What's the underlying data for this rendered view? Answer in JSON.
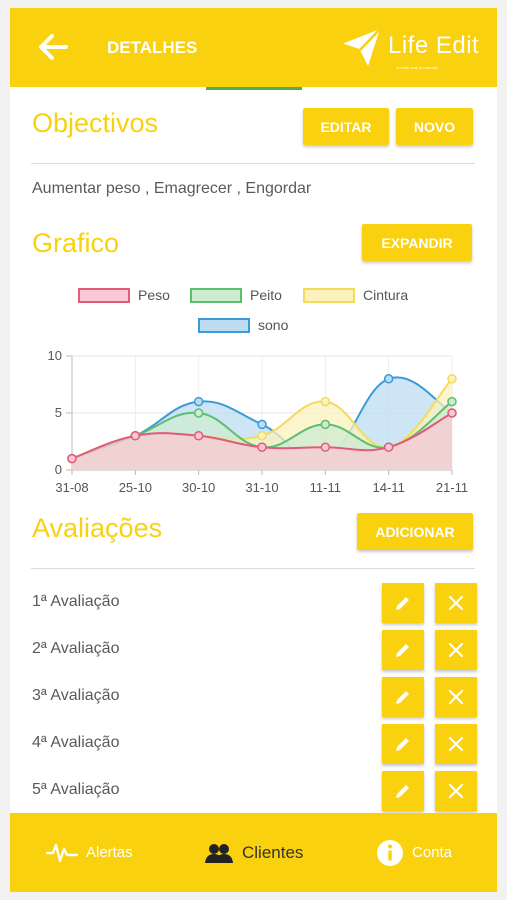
{
  "header": {
    "title": "DETALHES",
    "logo_text": "Life Edit",
    "logo_tagline": "a better way to manage"
  },
  "objectives": {
    "title": "Objectivos",
    "edit_label": "EDITAR",
    "new_label": "NOVO",
    "text": "Aumentar peso , Emagrecer , Engordar"
  },
  "chart_section": {
    "title": "Grafico",
    "expand_label": "EXPANDIR"
  },
  "chart_data": {
    "type": "area",
    "categories": [
      "31-08",
      "25-10",
      "30-10",
      "31-10",
      "11-11",
      "14-11",
      "21-11"
    ],
    "ylim": [
      0,
      10
    ],
    "yticks": [
      "0",
      "5",
      "10"
    ],
    "grid": true,
    "legend_position": "top",
    "series": [
      {
        "name": "Peso",
        "values": [
          1,
          3,
          3,
          2,
          2,
          2,
          5
        ],
        "color": "#e05a7a",
        "fill": "#f8c9d4"
      },
      {
        "name": "Peito",
        "values": [
          1,
          3,
          5,
          2,
          4,
          2,
          6
        ],
        "color": "#5cbf6e",
        "fill": "#cdebd1"
      },
      {
        "name": "Cintura",
        "values": [
          1,
          3,
          3,
          3,
          6,
          2,
          8
        ],
        "color": "#f2dc5a",
        "fill": "#fbf1bd"
      },
      {
        "name": "sono",
        "values": [
          1,
          3,
          6,
          4,
          1,
          8,
          5
        ],
        "color": "#3d9ad8",
        "fill": "#bcdcf1"
      }
    ]
  },
  "evaluations": {
    "title": "Avaliações",
    "add_label": "ADICIONAR",
    "items": [
      {
        "label": "1ª Avaliação"
      },
      {
        "label": "2ª Avaliação"
      },
      {
        "label": "3ª Avaliação"
      },
      {
        "label": "4ª Avaliação"
      },
      {
        "label": "5ª Avaliação"
      }
    ]
  },
  "bottom_nav": {
    "items": [
      {
        "label": "Alertas",
        "icon": "heartbeat-icon"
      },
      {
        "label": "Clientes",
        "icon": "users-icon"
      },
      {
        "label": "Conta",
        "icon": "info-icon"
      }
    ]
  },
  "colors": {
    "accent": "#f9d10f",
    "text": "#5a5a5a",
    "active_tab": "#4caf50"
  }
}
